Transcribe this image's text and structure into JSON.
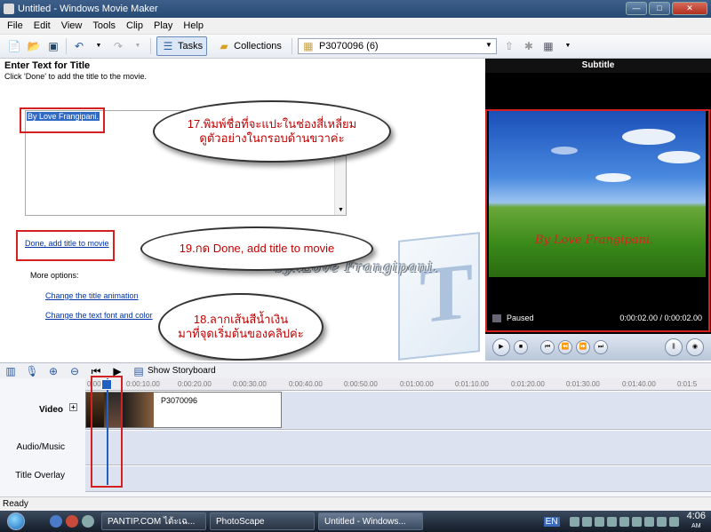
{
  "window": {
    "title": "Untitled - Windows Movie Maker"
  },
  "menu": [
    "File",
    "Edit",
    "View",
    "Tools",
    "Clip",
    "Play",
    "Help"
  ],
  "toolbar": {
    "tasks": "Tasks",
    "collections": "Collections",
    "collection_select": "P3070096 (6)"
  },
  "taskpane": {
    "heading": "Enter Text for Title",
    "instruction": "Click 'Done' to add the title to the movie.",
    "title_text": "By Love Frangipani.",
    "done_link": "Done, add title to movie",
    "more_options": "More options:",
    "change_animation": "Change the title animation",
    "change_font": "Change the text font and color",
    "watermark_credit": "by..Love Frangipani."
  },
  "callouts": {
    "step17": "17.พิมพ์ชื่อที่จะแปะในช่องสี่เหลี่ยม\nดูตัวอย่างในกรอบด้านขวาค่ะ",
    "step19": "19.กด Done, add title to movie",
    "step18": "18.ลากเส้นสีน้ำเงิน\nมาที่จุดเริ่มต้นของคลิปค่ะ"
  },
  "monitor": {
    "heading": "Subtitle",
    "overlay_text": "By Love Frangipani.",
    "status": "Paused",
    "time": "0:00:02.00 / 0:00:02.00"
  },
  "timeline": {
    "show_storyboard": "Show Storyboard",
    "ruler": [
      "0:00",
      "0:00:10.00",
      "0:00:20.00",
      "0:00:30.00",
      "0:00:40.00",
      "0:00:50.00",
      "0:01:00.00",
      "0:01:10.00",
      "0:01:20.00",
      "0:01:30.00",
      "0:01:40.00",
      "0:01:5"
    ],
    "tracks": {
      "video": "Video",
      "audio": "Audio/Music",
      "title": "Title Overlay"
    },
    "clip_name": "P3070096"
  },
  "status": {
    "text": "Ready"
  },
  "taskbar": {
    "tasks": [
      "PANTIP.COM ได้ะเฉ...",
      "PhotoScape",
      "Untitled - Windows..."
    ],
    "lang": "EN",
    "time": "4:06",
    "ampm": "AM"
  }
}
